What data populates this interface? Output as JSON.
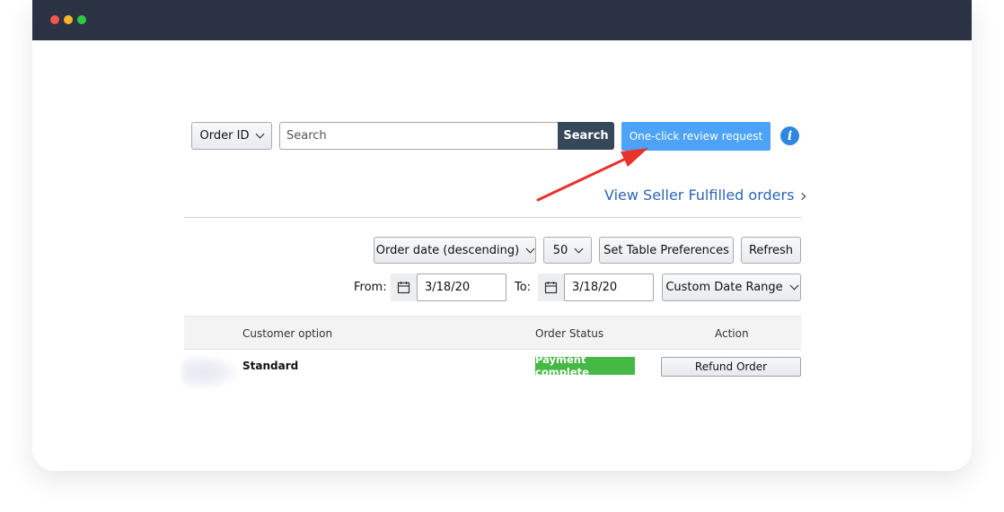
{
  "window": {
    "controls": [
      "close",
      "minimize",
      "maximize"
    ]
  },
  "search": {
    "type_select": "Order ID",
    "placeholder": "Search",
    "search_button": "Search",
    "review_button": "One-click review request",
    "info_icon": "i"
  },
  "seller_link": "View Seller Fulfilled orders",
  "controls": {
    "sort_select": "Order date (descending)",
    "page_size": "50",
    "table_prefs_button": "Set Table Preferences",
    "refresh_button": "Refresh",
    "from_label": "From:",
    "from_date": "3/18/20",
    "to_label": "To:",
    "to_date": "3/18/20",
    "date_range_select": "Custom Date Range"
  },
  "table": {
    "headers": [
      "Customer option",
      "Order Status",
      "Action"
    ],
    "rows": [
      {
        "customer_option": "Standard",
        "status": "Payment complete",
        "action": "Refund Order"
      }
    ]
  },
  "colors": {
    "titlebar": "#2b3244",
    "search_button": "#37475a",
    "review_button": "#4da3f8",
    "link": "#2b66b6",
    "status_badge": "#46b845",
    "annotation_arrow": "#e8322b"
  }
}
